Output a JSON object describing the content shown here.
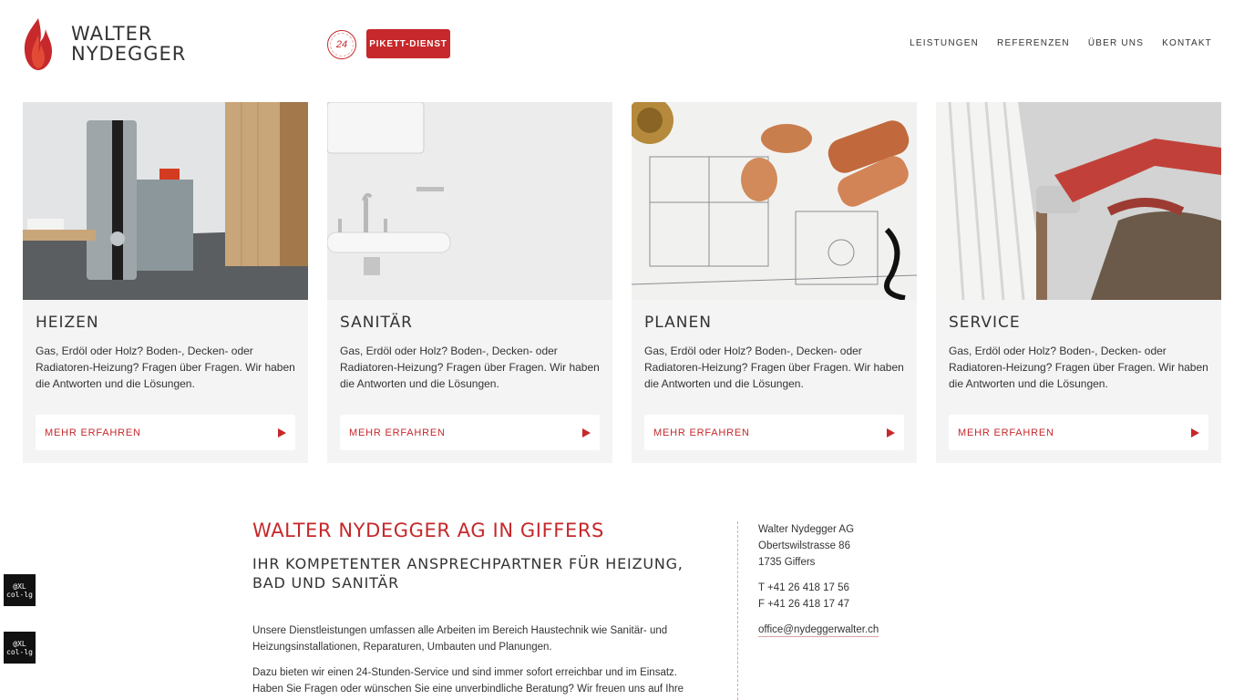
{
  "brand": {
    "line1": "WALTER",
    "line2": "NYDEGGER",
    "accent": "#c6282b"
  },
  "header": {
    "badge_24": "24",
    "pikett_label": "PIKETT-DIENST",
    "nav": [
      "LEISTUNGEN",
      "REFERENZEN",
      "ÜBER UNS",
      "KONTAKT"
    ]
  },
  "cards": [
    {
      "title": "HEIZEN",
      "text": "Gas, Erdöl oder Holz? Boden-, Decken- oder Radiatoren-Heizung? Fragen über Fragen. Wir haben die Antworten und die Lösungen.",
      "button": "MEHR ERFAHREN"
    },
    {
      "title": "SANITÄR",
      "text": "Gas, Erdöl oder Holz? Boden-, Decken- oder Radiatoren-Heizung? Fragen über Fragen. Wir haben die Antworten und die Lösungen.",
      "button": "MEHR ERFAHREN"
    },
    {
      "title": "PLANEN",
      "text": "Gas, Erdöl oder Holz? Boden-, Decken- oder Radiatoren-Heizung? Fragen über Fragen. Wir haben die Antworten und die Lösungen.",
      "button": "MEHR ERFAHREN"
    },
    {
      "title": "SERVICE",
      "text": "Gas, Erdöl oder Holz? Boden-, Decken- oder Radiatoren-Heizung? Fragen über Fragen. Wir haben die Antworten und die Lösungen.",
      "button": "MEHR ERFAHREN"
    }
  ],
  "content": {
    "title": "WALTER NYDEGGER AG IN GIFFERS",
    "subtitle": "IHR KOMPETENTER ANSPRECHPARTNER FÜR HEIZUNG, BAD UND SANITÄR",
    "p1": "Unsere Dienstleistungen umfassen alle Arbeiten im Bereich Haustechnik wie Sanitär- und Heizungsinstallationen, Reparaturen, Umbauten und Planungen.",
    "p2": "Dazu bieten wir einen 24-Stunden-Service und sind immer sofort erreichbar und im Einsatz. Haben Sie Fragen oder wünschen Sie eine unverbindliche Beratung? Wir freuen uns auf Ihre"
  },
  "address": {
    "company": "Walter Nydegger AG",
    "street": "Obertswilstrasse 86",
    "city": "1735 Giffers",
    "phone": "T +41 26 418 17 56",
    "fax": "F +41 26 418 17 47",
    "email": "office@nydeggerwalter.ch"
  },
  "debug_badges": [
    {
      "line1": "@XL",
      "line2": "col-lg"
    },
    {
      "line1": "@XL",
      "line2": "col-lg"
    }
  ]
}
